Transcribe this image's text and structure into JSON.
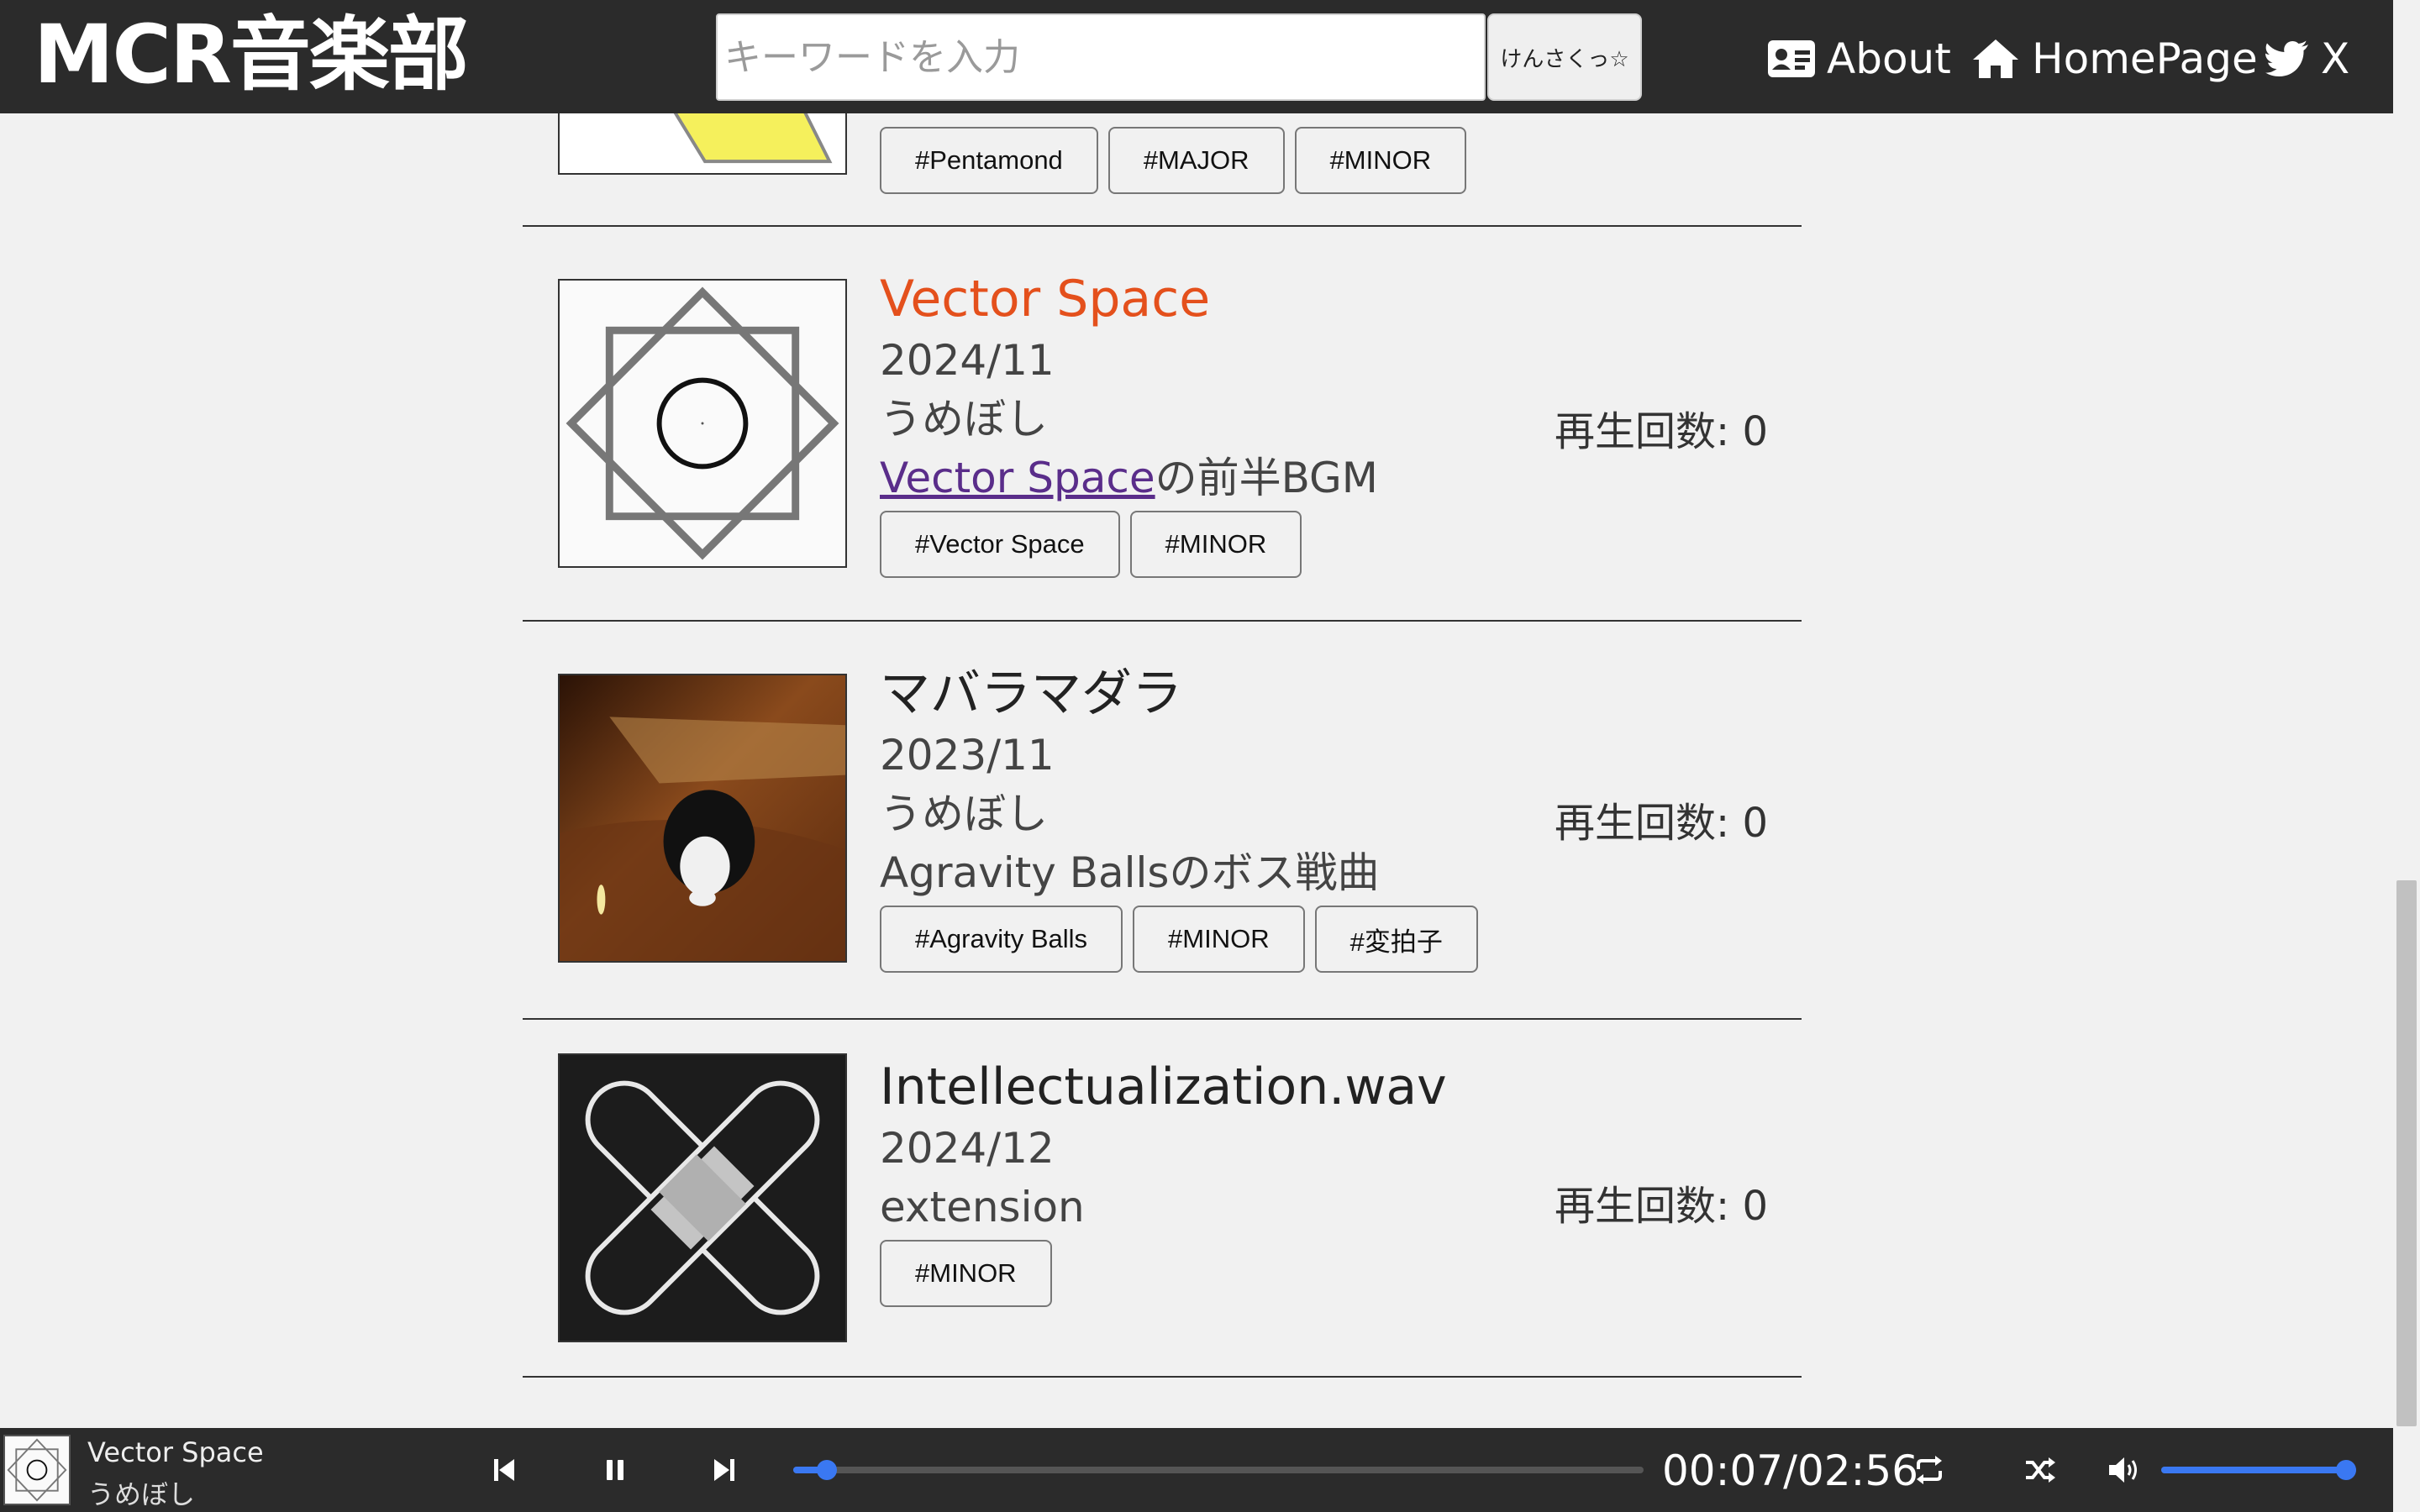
{
  "header": {
    "logo": "MCR音楽部",
    "search_placeholder": "キーワードを入力",
    "search_button": "けんさくっ☆",
    "nav": {
      "about": "About",
      "homepage": "HomePage",
      "x": "X"
    }
  },
  "tracks": [
    {
      "tags": [
        "#Pentamond",
        "#MAJOR",
        "#MINOR"
      ]
    },
    {
      "title": "Vector Space",
      "date": "2024/11",
      "artist": "うめぼし",
      "desc_link": "Vector Space",
      "desc_rest": "の前半BGM",
      "plays": "再生回数: 0",
      "tags": [
        "#Vector Space",
        "#MINOR"
      ],
      "now_playing": true
    },
    {
      "title": "マバラマダラ",
      "date": "2023/11",
      "artist": "うめぼし",
      "desc": "Agravity Ballsのボス戦曲",
      "plays": "再生回数: 0",
      "tags": [
        "#Agravity Balls",
        "#MINOR",
        "#変拍子"
      ]
    },
    {
      "title": "Intellectualization.wav",
      "date": "2024/12",
      "artist": "extension",
      "plays": "再生回数: 0",
      "tags": [
        "#MINOR"
      ]
    }
  ],
  "player": {
    "title": "Vector Space",
    "artist": "うめぼし",
    "time": "00:07/02:56",
    "progress": 0.04,
    "volume": 1.0
  },
  "colors": {
    "header_bg": "#2b2b2b",
    "page_bg": "#f1f1f1",
    "active_title": "#e4501c",
    "link": "#5a2d8a",
    "slider": "#3a78f2"
  }
}
